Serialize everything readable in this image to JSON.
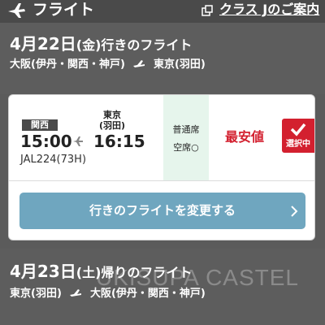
{
  "header": {
    "title": "フライト",
    "link_label": "クラス Jのご案内"
  },
  "outbound": {
    "date_main": "4月22日",
    "day_of_week": "(金)",
    "date_suffix": "行きのフライト",
    "from": "大阪(伊丹・関西・神戸)",
    "to": "東京(羽田)"
  },
  "flight_card": {
    "departure_airport_badge": "関西",
    "arrival_airport_line1": "東京",
    "arrival_airport_line2": "(羽田)",
    "departure_time": "15:00",
    "arrival_time": "16:15",
    "flight_number": "JAL224(73H)",
    "seat_class": "普通席",
    "seat_availability": "空席○",
    "price_label": "最安値",
    "selected_label": "選択中",
    "change_button_label": "行きのフライトを変更する"
  },
  "return": {
    "date_main": "4月23日",
    "day_of_week": "(土)",
    "date_suffix": "帰りのフライト",
    "from": "東京(羽田)",
    "to": "大阪(伊丹・関西・神戸)"
  },
  "watermark": "UKISUPA CASTEL",
  "colors": {
    "header_bg": "#4a4a4a",
    "section_bg": "#5d5d5d",
    "accent_red": "#d3202f",
    "button_blue": "#6fa6bf",
    "seat_bg": "#e6f5ec"
  }
}
